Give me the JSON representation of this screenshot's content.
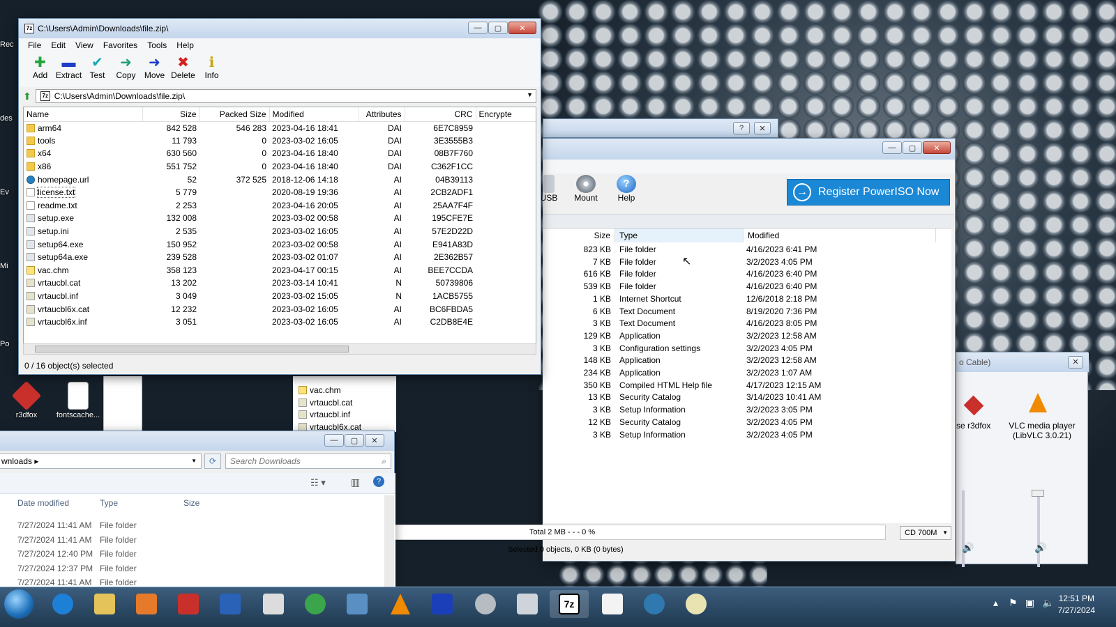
{
  "desktop": {
    "icons": [
      {
        "label": "r3dfox"
      },
      {
        "label": "fontscache..."
      }
    ],
    "edge_labels": [
      "Rec",
      "des",
      "Ev",
      "Mi",
      "Po"
    ],
    "right_icons": [
      {
        "label": "se r3dfox"
      },
      {
        "label": "VLC media player (LibVLC 3.0.21)"
      }
    ],
    "bg_window_title_fragment": "o Cable)"
  },
  "sevenzip": {
    "title": "C:\\Users\\Admin\\Downloads\\file.zip\\",
    "menu": [
      "File",
      "Edit",
      "View",
      "Favorites",
      "Tools",
      "Help"
    ],
    "toolbar": [
      {
        "label": "Add",
        "icon": "plus-icon",
        "color": "#22a33a"
      },
      {
        "label": "Extract",
        "icon": "minus-icon",
        "color": "#1d3cc9"
      },
      {
        "label": "Test",
        "icon": "check-icon",
        "color": "#18a7b5"
      },
      {
        "label": "Copy",
        "icon": "copy-arrow-icon",
        "color": "#1f9f7a"
      },
      {
        "label": "Move",
        "icon": "move-arrow-icon",
        "color": "#1d3cc9"
      },
      {
        "label": "Delete",
        "icon": "x-icon",
        "color": "#d62020"
      },
      {
        "label": "Info",
        "icon": "info-icon",
        "color": "#c9a500"
      }
    ],
    "address": "C:\\Users\\Admin\\Downloads\\file.zip\\",
    "columns": [
      "Name",
      "Size",
      "Packed Size",
      "Modified",
      "Attributes",
      "CRC",
      "Encrypte"
    ],
    "rows": [
      {
        "icon": "folder",
        "name": "arm64",
        "size": "842 528",
        "packed": "546 283",
        "modified": "2023-04-16 18:41",
        "attr": "DAI",
        "crc": "6E7C8959"
      },
      {
        "icon": "folder",
        "name": "tools",
        "size": "11 793",
        "packed": "0",
        "modified": "2023-03-02 16:05",
        "attr": "DAI",
        "crc": "3E3555B3"
      },
      {
        "icon": "folder",
        "name": "x64",
        "size": "630 560",
        "packed": "0",
        "modified": "2023-04-16 18:40",
        "attr": "DAI",
        "crc": "08B7F760"
      },
      {
        "icon": "folder",
        "name": "x86",
        "size": "551 752",
        "packed": "0",
        "modified": "2023-04-16 18:40",
        "attr": "DAI",
        "crc": "C362F1CC"
      },
      {
        "icon": "globe",
        "name": "homepage.url",
        "size": "52",
        "packed": "372 525",
        "modified": "2018-12-06 14:18",
        "attr": "AI",
        "crc": "04B39113"
      },
      {
        "icon": "file",
        "name": "license.txt",
        "size": "5 779",
        "packed": "",
        "modified": "2020-08-19 19:36",
        "attr": "AI",
        "crc": "2CB2ADF1"
      },
      {
        "icon": "file",
        "name": "readme.txt",
        "size": "2 253",
        "packed": "",
        "modified": "2023-04-16 20:05",
        "attr": "AI",
        "crc": "25AA7F4F"
      },
      {
        "icon": "exe",
        "name": "setup.exe",
        "size": "132 008",
        "packed": "",
        "modified": "2023-03-02 00:58",
        "attr": "AI",
        "crc": "195CFE7E"
      },
      {
        "icon": "exe",
        "name": "setup.ini",
        "size": "2 535",
        "packed": "",
        "modified": "2023-03-02 16:05",
        "attr": "AI",
        "crc": "57E2D22D"
      },
      {
        "icon": "exe",
        "name": "setup64.exe",
        "size": "150 952",
        "packed": "",
        "modified": "2023-03-02 00:58",
        "attr": "AI",
        "crc": "E941A83D"
      },
      {
        "icon": "exe",
        "name": "setup64a.exe",
        "size": "239 528",
        "packed": "",
        "modified": "2023-03-02 01:07",
        "attr": "AI",
        "crc": "2E362B57"
      },
      {
        "icon": "help",
        "name": "vac.chm",
        "size": "358 123",
        "packed": "",
        "modified": "2023-04-17 00:15",
        "attr": "AI",
        "crc": "BEE7CCDA"
      },
      {
        "icon": "cat",
        "name": "vrtaucbl.cat",
        "size": "13 202",
        "packed": "",
        "modified": "2023-03-14 10:41",
        "attr": "N",
        "crc": "50739806"
      },
      {
        "icon": "cat",
        "name": "vrtaucbl.inf",
        "size": "3 049",
        "packed": "",
        "modified": "2023-03-02 15:05",
        "attr": "N",
        "crc": "1ACB5755"
      },
      {
        "icon": "cat",
        "name": "vrtaucbl6x.cat",
        "size": "12 232",
        "packed": "",
        "modified": "2023-03-02 16:05",
        "attr": "AI",
        "crc": "BC6FBDA5"
      },
      {
        "icon": "cat",
        "name": "vrtaucbl6x.inf",
        "size": "3 051",
        "packed": "",
        "modified": "2023-03-02 16:05",
        "attr": "AI",
        "crc": "C2DB8E4E"
      }
    ],
    "status": "0 / 16 object(s) selected"
  },
  "poweriso": {
    "tools": [
      {
        "label": "USB"
      },
      {
        "label": "Mount"
      },
      {
        "label": "Help"
      }
    ],
    "register_label": "Register PowerISO Now",
    "columns": [
      "Size",
      "Type",
      "Modified"
    ],
    "rows": [
      {
        "size": "823 KB",
        "type": "File folder",
        "modified": "4/16/2023 6:41 PM"
      },
      {
        "size": "7 KB",
        "type": "File folder",
        "modified": "3/2/2023 4:05 PM"
      },
      {
        "size": "616 KB",
        "type": "File folder",
        "modified": "4/16/2023 6:40 PM"
      },
      {
        "size": "539 KB",
        "type": "File folder",
        "modified": "4/16/2023 6:40 PM"
      },
      {
        "size": "1 KB",
        "type": "Internet Shortcut",
        "modified": "12/6/2018 2:18 PM"
      },
      {
        "size": "6 KB",
        "type": "Text Document",
        "modified": "8/19/2020 7:36 PM"
      },
      {
        "size": "3 KB",
        "type": "Text Document",
        "modified": "4/16/2023 8:05 PM"
      },
      {
        "size": "129 KB",
        "type": "Application",
        "modified": "3/2/2023 12:58 AM"
      },
      {
        "size": "3 KB",
        "type": "Configuration settings",
        "modified": "3/2/2023 4:05 PM"
      },
      {
        "size": "148 KB",
        "type": "Application",
        "modified": "3/2/2023 12:58 AM"
      },
      {
        "size": "234 KB",
        "type": "Application",
        "modified": "3/2/2023 1:07 AM"
      },
      {
        "size": "350 KB",
        "type": "Compiled HTML Help file",
        "modified": "4/17/2023 12:15 AM"
      },
      {
        "size": "13 KB",
        "type": "Security Catalog",
        "modified": "3/14/2023 10:41 AM"
      },
      {
        "size": "3 KB",
        "type": "Setup Information",
        "modified": "3/2/2023 3:05 PM"
      },
      {
        "size": "12 KB",
        "type": "Security Catalog",
        "modified": "3/2/2023 4:05 PM"
      },
      {
        "size": "3 KB",
        "type": "Setup Information",
        "modified": "3/2/2023 4:05 PM"
      }
    ],
    "tree_items": [
      "vac.chm",
      "vrtaucbl.cat",
      "vrtaucbl.inf",
      "vrtaucbl6x.cat"
    ],
    "total": "Total  2 MB   - - -  0 %",
    "media": "CD 700M",
    "selected": "Selected 0 objects, 0 KB (0 bytes)"
  },
  "explorer": {
    "breadcrumb": "wnloads",
    "search_placeholder": "Search Downloads",
    "columns": [
      "Date modified",
      "Type",
      "Size"
    ],
    "rows": [
      {
        "date": "7/27/2024 11:41 AM",
        "type": "File folder"
      },
      {
        "date": "7/27/2024 11:41 AM",
        "type": "File folder"
      },
      {
        "date": "7/27/2024 12:40 PM",
        "type": "File folder"
      },
      {
        "date": "7/27/2024 12:37 PM",
        "type": "File folder"
      },
      {
        "date": "7/27/2024 11:41 AM",
        "type": "File folder"
      }
    ]
  },
  "taskbar": {
    "time": "12:51 PM",
    "date": "7/27/2024",
    "sevenzip_label": "7z"
  }
}
